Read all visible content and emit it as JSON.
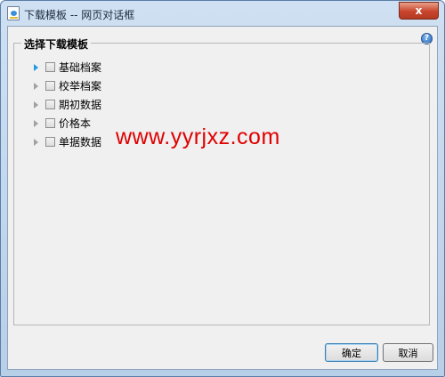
{
  "window": {
    "title": "下载模板 -- 网页对话框",
    "close_label": "x"
  },
  "help": {
    "label": "?"
  },
  "group": {
    "legend": "选择下载模板",
    "items": [
      {
        "label": "基础档案",
        "selected": true
      },
      {
        "label": "校举档案",
        "selected": false
      },
      {
        "label": "期初数据",
        "selected": false
      },
      {
        "label": "价格本",
        "selected": false
      },
      {
        "label": "单据数据",
        "selected": false
      }
    ]
  },
  "watermark": {
    "text": "www.yyrjxz.com"
  },
  "buttons": {
    "ok_label": "确定",
    "cancel_label": "取消"
  }
}
